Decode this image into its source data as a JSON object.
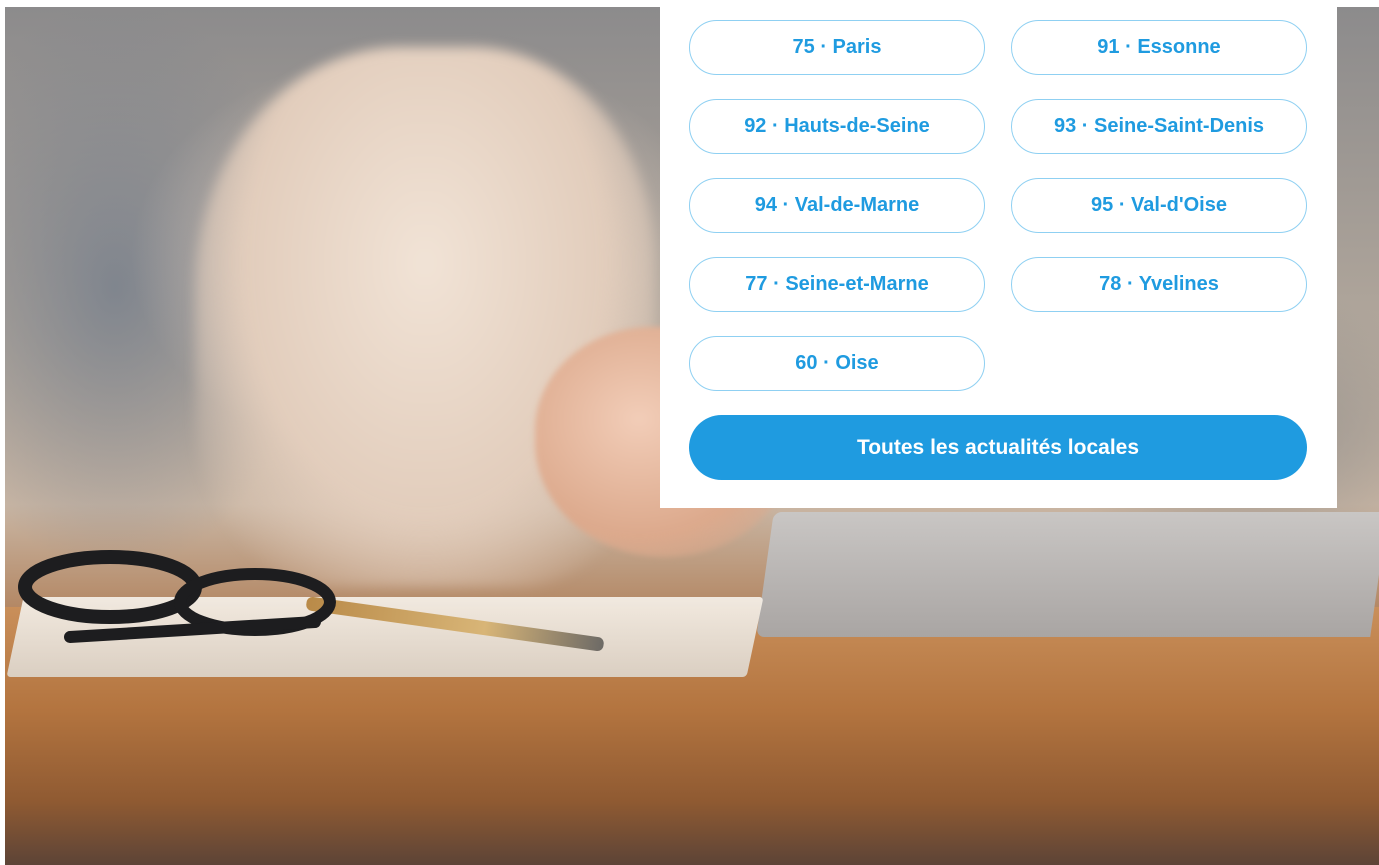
{
  "departments": [
    {
      "label": "75 · Paris"
    },
    {
      "label": "91 · Essonne"
    },
    {
      "label": "92 · Hauts-de-Seine"
    },
    {
      "label": "93 · Seine-Saint-Denis"
    },
    {
      "label": "94 · Val-de-Marne"
    },
    {
      "label": "95 · Val-d'Oise"
    },
    {
      "label": "77 · Seine-et-Marne"
    },
    {
      "label": "78 · Yvelines"
    },
    {
      "label": "60 · Oise"
    }
  ],
  "cta": {
    "label": "Toutes les actualités locales"
  },
  "colors": {
    "accent": "#1f9be0",
    "pill_border": "#8fd0f2",
    "panel_bg": "#ffffff"
  }
}
